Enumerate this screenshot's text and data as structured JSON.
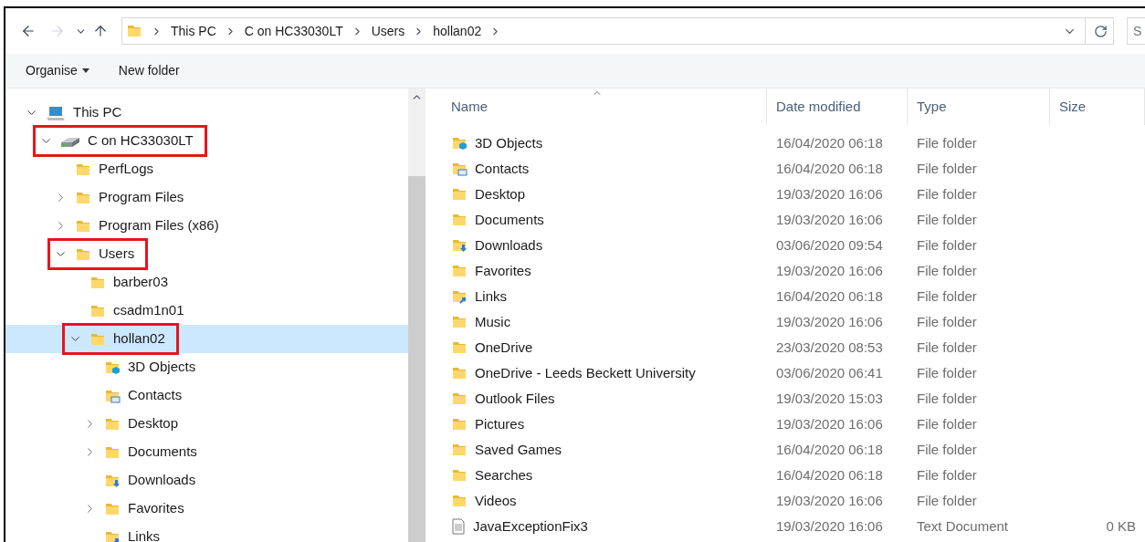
{
  "address_bar": {
    "crumbs": [
      "This PC",
      "C on HC33030LT",
      "Users",
      "hollan02"
    ],
    "search_placeholder": "S"
  },
  "command_bar": [
    {
      "label": "Organise",
      "dropdown": true
    },
    {
      "label": "New folder",
      "dropdown": false
    }
  ],
  "tree": [
    {
      "label": "This PC",
      "kind": "pc",
      "expanded": true,
      "selected": false,
      "highlighted": false,
      "children": [
        {
          "label": "C on HC33030LT",
          "kind": "drive",
          "expanded": true,
          "selected": false,
          "highlighted": true,
          "children": [
            {
              "label": "PerfLogs",
              "kind": "folder",
              "selected": false,
              "highlighted": false
            },
            {
              "label": "Program Files",
              "kind": "folder",
              "expanded": false,
              "selected": false,
              "highlighted": false
            },
            {
              "label": "Program Files (x86)",
              "kind": "folder",
              "expanded": false,
              "selected": false,
              "highlighted": false
            },
            {
              "label": "Users",
              "kind": "folder",
              "expanded": true,
              "selected": false,
              "highlighted": true,
              "children": [
                {
                  "label": "barber03",
                  "kind": "folder",
                  "selected": false,
                  "highlighted": false
                },
                {
                  "label": "csadm1n01",
                  "kind": "folder",
                  "selected": false,
                  "highlighted": false
                },
                {
                  "label": "hollan02",
                  "kind": "folder",
                  "expanded": true,
                  "selected": true,
                  "highlighted": true,
                  "children": [
                    {
                      "label": "3D Objects",
                      "kind": "cube",
                      "selected": false,
                      "highlighted": false
                    },
                    {
                      "label": "Contacts",
                      "kind": "contacts",
                      "selected": false,
                      "highlighted": false
                    },
                    {
                      "label": "Desktop",
                      "kind": "folder",
                      "expanded": false,
                      "selected": false,
                      "highlighted": false
                    },
                    {
                      "label": "Documents",
                      "kind": "folder",
                      "expanded": false,
                      "selected": false,
                      "highlighted": false
                    },
                    {
                      "label": "Downloads",
                      "kind": "download",
                      "selected": false,
                      "highlighted": false
                    },
                    {
                      "label": "Favorites",
                      "kind": "folder",
                      "expanded": false,
                      "selected": false,
                      "highlighted": false
                    },
                    {
                      "label": "Links",
                      "kind": "link",
                      "selected": false,
                      "highlighted": false
                    }
                  ]
                }
              ]
            }
          ]
        }
      ]
    }
  ],
  "table": {
    "columns": [
      "Name",
      "Date modified",
      "Type",
      "Size"
    ],
    "rows": [
      {
        "name": "3D Objects",
        "kind": "cube",
        "date": "16/04/2020 06:18",
        "type": "File folder"
      },
      {
        "name": "Contacts",
        "kind": "contacts",
        "date": "16/04/2020 06:18",
        "type": "File folder"
      },
      {
        "name": "Desktop",
        "kind": "folder",
        "date": "19/03/2020 16:06",
        "type": "File folder"
      },
      {
        "name": "Documents",
        "kind": "folder",
        "date": "19/03/2020 16:06",
        "type": "File folder"
      },
      {
        "name": "Downloads",
        "kind": "download",
        "date": "03/06/2020 09:54",
        "type": "File folder"
      },
      {
        "name": "Favorites",
        "kind": "folder",
        "date": "19/03/2020 16:06",
        "type": "File folder"
      },
      {
        "name": "Links",
        "kind": "link",
        "date": "16/04/2020 06:18",
        "type": "File folder"
      },
      {
        "name": "Music",
        "kind": "folder",
        "date": "19/03/2020 16:06",
        "type": "File folder"
      },
      {
        "name": "OneDrive",
        "kind": "folder",
        "date": "23/03/2020 08:53",
        "type": "File folder"
      },
      {
        "name": "OneDrive - Leeds Beckett University",
        "kind": "folder",
        "date": "03/06/2020 06:41",
        "type": "File folder"
      },
      {
        "name": "Outlook Files",
        "kind": "folder",
        "date": "19/03/2020 15:03",
        "type": "File folder"
      },
      {
        "name": "Pictures",
        "kind": "folder",
        "date": "19/03/2020 16:06",
        "type": "File folder"
      },
      {
        "name": "Saved Games",
        "kind": "folder",
        "date": "16/04/2020 06:18",
        "type": "File folder"
      },
      {
        "name": "Searches",
        "kind": "folder",
        "date": "16/04/2020 06:18",
        "type": "File folder"
      },
      {
        "name": "Videos",
        "kind": "folder",
        "date": "19/03/2020 16:06",
        "type": "File folder"
      },
      {
        "name": "JavaExceptionFix3",
        "kind": "text",
        "date": "19/03/2020 16:06",
        "type": "Text Document",
        "size": "0 KB"
      }
    ]
  }
}
